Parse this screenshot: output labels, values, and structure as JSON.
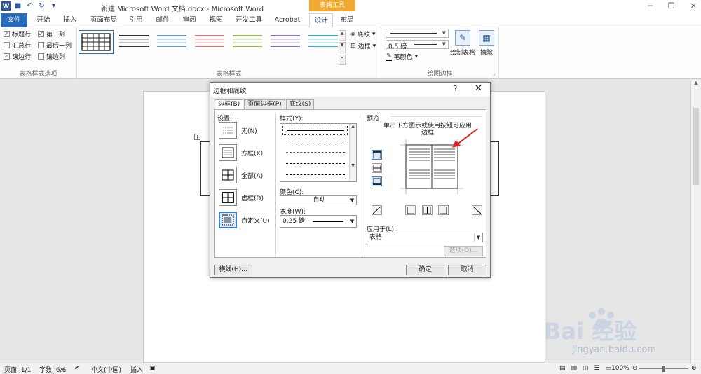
{
  "window": {
    "title": "新建 Microsoft Word 文档.docx - Microsoft Word",
    "context_tab_group": "表格工具"
  },
  "ribbon_tabs": [
    "文件",
    "开始",
    "插入",
    "页面布局",
    "引用",
    "邮件",
    "审阅",
    "视图",
    "开发工具",
    "Acrobat",
    "设计",
    "布局"
  ],
  "active_tab": "设计",
  "style_options": {
    "items": [
      {
        "label": "标题行",
        "checked": true
      },
      {
        "label": "第一列",
        "checked": true
      },
      {
        "label": "汇总行",
        "checked": false
      },
      {
        "label": "最后一列",
        "checked": false
      },
      {
        "label": "镶边行",
        "checked": true
      },
      {
        "label": "镶边列",
        "checked": false
      }
    ],
    "group_label": "表格样式选项"
  },
  "table_styles": {
    "group_label": "表格样式",
    "swatch_colors": [
      "#333333",
      "#4a4a4a",
      "#6f9bd1",
      "#d98080",
      "#9bbb59",
      "#8b76b5",
      "#4bacc6"
    ]
  },
  "shading": {
    "label": "底纹",
    "border_label": "边框"
  },
  "draw_borders": {
    "group_label": "绘图边框",
    "pen_weight": "0.5 磅",
    "pen_color_label": "笔颜色",
    "draw_table_label": "绘制表格",
    "eraser_label": "擦除"
  },
  "dialog": {
    "title": "边框和底纹",
    "help": "?",
    "close": "✕",
    "tabs": [
      "边框(B)",
      "页面边框(P)",
      "底纹(S)"
    ],
    "settings_label": "设置:",
    "settings": [
      {
        "label": "无(N)"
      },
      {
        "label": "方框(X)"
      },
      {
        "label": "全部(A)"
      },
      {
        "label": "虚框(D)"
      },
      {
        "label": "自定义(U)",
        "selected": true
      }
    ],
    "style_label": "样式(Y):",
    "color_label": "颜色(C):",
    "color_value": "自动",
    "width_label": "宽度(W):",
    "width_value": "0.25 磅",
    "preview_label": "预览",
    "preview_hint": "单击下方图示或使用按钮可应用边框",
    "apply_to_label": "应用于(L):",
    "apply_to_value": "表格",
    "options_button": "选项(O)...",
    "horizontal_line_button": "横线(H)...",
    "ok": "确定",
    "cancel": "取消"
  },
  "status": {
    "page": "页面: 1/1",
    "words": "字数: 6/6",
    "language": "中文(中国)",
    "insert_mode": "插入",
    "zoom": "100%"
  },
  "watermark": {
    "logo": "Bai 经验",
    "url": "jingyan.baidu.com"
  }
}
